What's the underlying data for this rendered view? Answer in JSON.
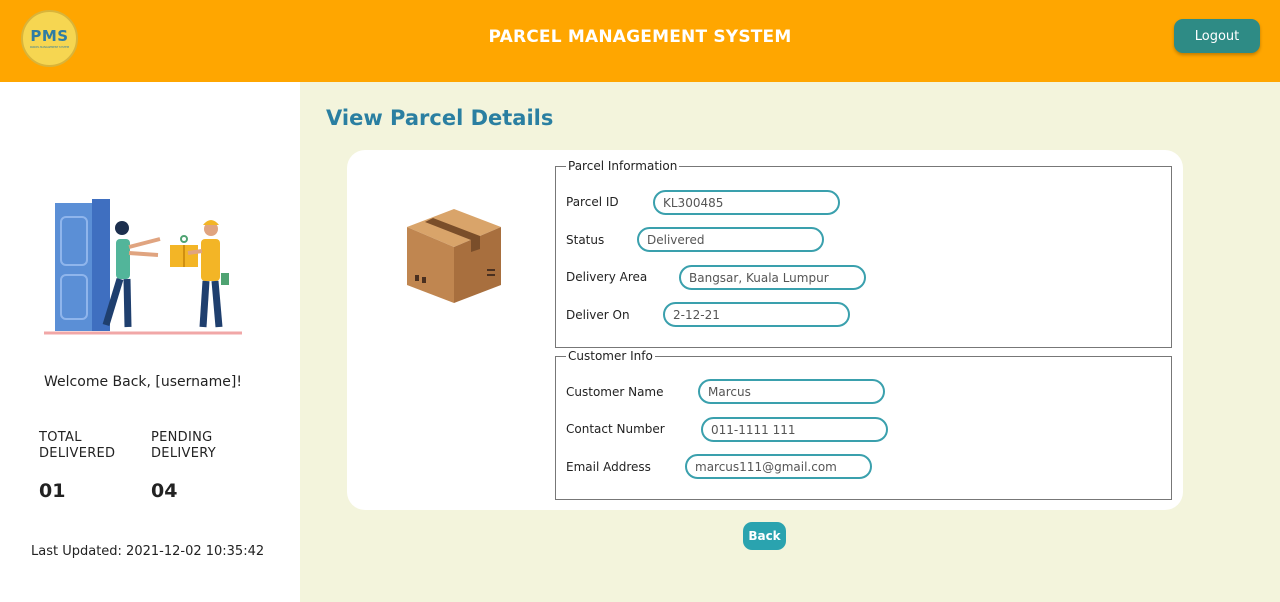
{
  "header": {
    "logo_text": "PMS",
    "logo_subtext": "PARCEL MANAGEMENT SYSTEM",
    "title": "PARCEL MANAGEMENT SYSTEM",
    "logout_label": "Logout",
    "bg_color": "#ffa600"
  },
  "sidebar": {
    "welcome": "Welcome Back, [username]!",
    "stats": [
      {
        "label_line1": "TOTAL",
        "label_line2": "DELIVERED",
        "value": "01"
      },
      {
        "label_line1": "PENDING",
        "label_line2": "DELIVERY",
        "value": "04"
      }
    ],
    "last_updated": "Last Updated: 2021-12-02 10:35:42"
  },
  "main": {
    "title": "View Parcel Details",
    "parcel_info": {
      "legend": "Parcel Information",
      "fields": [
        {
          "label": "Parcel ID",
          "value": "KL300485"
        },
        {
          "label": "Status",
          "value": "Delivered"
        },
        {
          "label": "Delivery Area",
          "value": "Bangsar, Kuala Lumpur"
        },
        {
          "label": "Deliver On",
          "value": "2-12-21"
        }
      ]
    },
    "customer_info": {
      "legend": "Customer Info",
      "fields": [
        {
          "label": "Customer Name",
          "value": "Marcus"
        },
        {
          "label": "Contact Number",
          "value": "011-1111 111"
        },
        {
          "label": "Email Address",
          "value": "marcus111@gmail.com"
        }
      ]
    },
    "back_label": "Back"
  }
}
